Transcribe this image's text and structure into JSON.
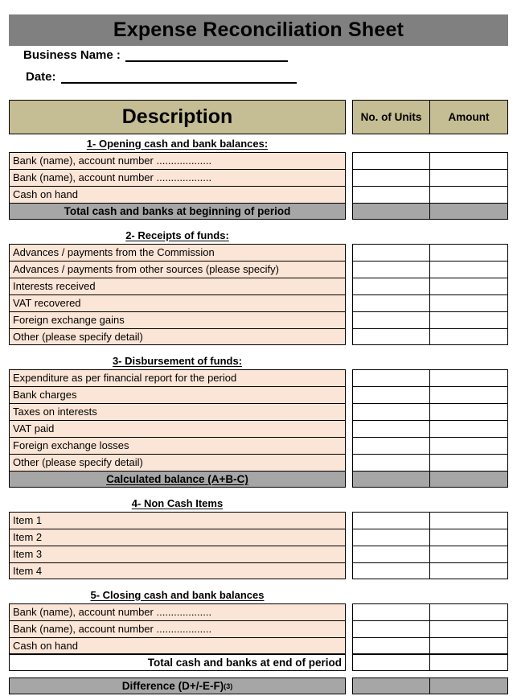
{
  "document": {
    "title": "Expense Reconciliation Sheet"
  },
  "fields": [
    {
      "label": "Business Name :",
      "value": ""
    },
    {
      "label": "Date:",
      "value": ""
    }
  ],
  "table_headers": {
    "description": "Description",
    "units": "No. of Units",
    "amount": "Amount"
  },
  "sections": [
    {
      "heading": "1- Opening cash and bank balances:",
      "rows": [
        {
          "label": "Bank (name), account number ...................",
          "units": "",
          "amount": ""
        },
        {
          "label": "Bank (name), account number ...................",
          "units": "",
          "amount": ""
        },
        {
          "label": "Cash on hand",
          "units": "",
          "amount": ""
        }
      ],
      "total": {
        "label": "Total cash and banks at beginning of period",
        "style": "gray",
        "underline": false,
        "units": "",
        "amount": ""
      }
    },
    {
      "heading": "2- Receipts of funds:",
      "rows": [
        {
          "label": "Advances / payments from the Commission",
          "units": "",
          "amount": ""
        },
        {
          "label": "Advances / payments from other sources (please specify)",
          "units": "",
          "amount": ""
        },
        {
          "label": "Interests received",
          "units": "",
          "amount": ""
        },
        {
          "label": "VAT recovered",
          "units": "",
          "amount": ""
        },
        {
          "label": "Foreign exchange gains",
          "units": "",
          "amount": ""
        },
        {
          "label": "Other (please specify detail)",
          "units": "",
          "amount": ""
        }
      ],
      "total": null
    },
    {
      "heading": "3- Disbursement of funds:",
      "rows": [
        {
          "label": "Expenditure as per financial report for the period",
          "units": "",
          "amount": ""
        },
        {
          "label": "Bank charges",
          "units": "",
          "amount": ""
        },
        {
          "label": "Taxes on interests",
          "units": "",
          "amount": ""
        },
        {
          "label": "VAT paid",
          "units": "",
          "amount": ""
        },
        {
          "label": "Foreign exchange losses",
          "units": "",
          "amount": ""
        },
        {
          "label": "Other (please specify detail)",
          "units": "",
          "amount": ""
        }
      ],
      "total": {
        "label": "Calculated balance (A+B-C)",
        "style": "gray",
        "underline": true,
        "units": "",
        "amount": ""
      }
    },
    {
      "heading": "4- Non Cash Items",
      "rows": [
        {
          "label": "Item 1",
          "units": "",
          "amount": ""
        },
        {
          "label": "Item 2",
          "units": "",
          "amount": ""
        },
        {
          "label": "Item 3",
          "units": "",
          "amount": ""
        },
        {
          "label": "Item 4",
          "units": "",
          "amount": ""
        }
      ],
      "total": null
    },
    {
      "heading": "5- Closing cash and bank balances",
      "rows": [
        {
          "label": "Bank (name), account number ...................",
          "units": "",
          "amount": ""
        },
        {
          "label": "Bank (name), account number ...................",
          "units": "",
          "amount": ""
        },
        {
          "label": "Cash on hand",
          "units": "",
          "amount": ""
        }
      ],
      "total": {
        "label": "Total cash and banks at end of period",
        "style": "white",
        "underline": false,
        "units": "",
        "amount": ""
      }
    }
  ],
  "final_row": {
    "label": "Difference (D+/-E-F)",
    "superscript": "(3)",
    "style": "gray",
    "units": "",
    "amount": ""
  },
  "colors": {
    "title_bar": "#808080",
    "table_header": "#c5bd93",
    "row_fill": "#fbe5d6",
    "total_fill": "#a6a6a6",
    "border": "#000000",
    "page": "#ffffff"
  }
}
